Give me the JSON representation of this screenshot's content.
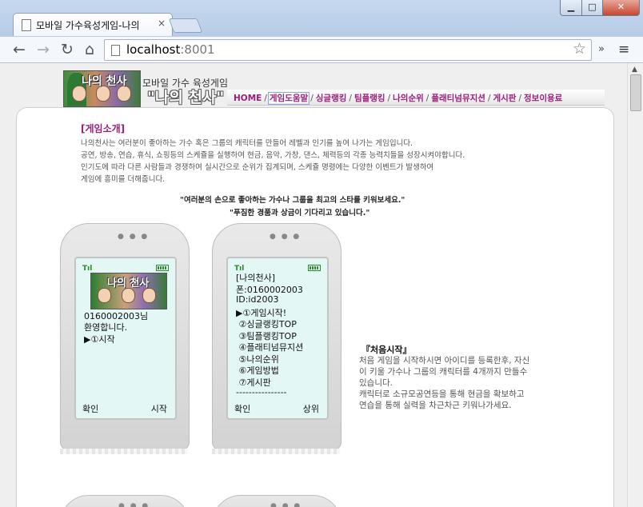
{
  "browser": {
    "tab_title": "모바일 가수육성게임-나의",
    "tab_close": "×",
    "url_host": "localhost",
    "url_port": ":8001",
    "back": "←",
    "forward": "→",
    "reload": "↻",
    "home": "⌂",
    "star": "☆",
    "extensions": "»",
    "menu": "≡",
    "window_min": "▁",
    "window_max": "□",
    "window_close": "✕"
  },
  "header": {
    "logo_text": "나의 천사",
    "brand_subtitle": "모바일 가수 육성게임",
    "brand_title": "\"나의 천사\"",
    "nav": [
      {
        "label": "HOME"
      },
      {
        "label": "게임도움말",
        "active": true
      },
      {
        "label": "싱글랭킹"
      },
      {
        "label": "팀플랭킹"
      },
      {
        "label": "나의순위"
      },
      {
        "label": "플래티넘뮤지션"
      },
      {
        "label": "게시판"
      },
      {
        "label": "정보이용료"
      }
    ],
    "nav_separator": "/"
  },
  "intro": {
    "title": "[게임소개]",
    "lines": [
      "나의천사는 여러분이 좋아하는 가수 혹은 그룹의 캐릭터를 만들어 레벨과 인기를 높여 나가는 게임입니다.",
      "공연, 방송, 연습, 휴식, 쇼핑등의 스케쥴을 실행하여 현금, 음악, 가창, 댄스, 체력등의 각종 능력치들을 성장시켜야합니다.",
      "인기도에 따라 다른 사람들과 경쟁하여 실시간으로 순위가 집계되며, 스케쥴 명령에는 다양한 이벤트가 발생하여",
      "게임에 흥미를 더해줍니다."
    ],
    "quote_1": "\"여러분의 손으로 좋아하는 가수나 그룹을 최고의 스타를 키워보세요.\"",
    "quote_2": "\"푸짐한 경품과 상금이 기다리고 있습니다.\""
  },
  "phone1": {
    "logo_text": "나의 천사",
    "lines": [
      "0160002003님",
      "환영합니다.",
      "▶①시작"
    ],
    "soft_left": "확인",
    "soft_right": "시작",
    "antenna": "Tıl"
  },
  "phone2": {
    "lines": [
      "[나의천사]",
      "폰:0160002003",
      "ID:id2003",
      "▶①게임시작!",
      " ②싱글랭킹TOP",
      " ③팀플랭킹TOP",
      " ④플래티넘뮤지션",
      " ⑤나의순위",
      " ⑥게임방법",
      " ⑦게시판",
      "----------------"
    ],
    "soft_left": "확인",
    "soft_right": "상위",
    "antenna": "Tıl"
  },
  "start_section": {
    "title": "『처음시작』",
    "lines": [
      "처음 게임을 시작하시면 아이디를 등록한후, 자신",
      "이 키울 가수나 그룹의 캐릭터를 4개까지 만들수",
      "있습니다.",
      "캐릭터로 소규모공연등을 통해 현금을 확보하고",
      "연습을 통해 실력을 차근차근 키워나가세요."
    ]
  },
  "phone_dots": "● ● ●",
  "scroll_up": "▲"
}
